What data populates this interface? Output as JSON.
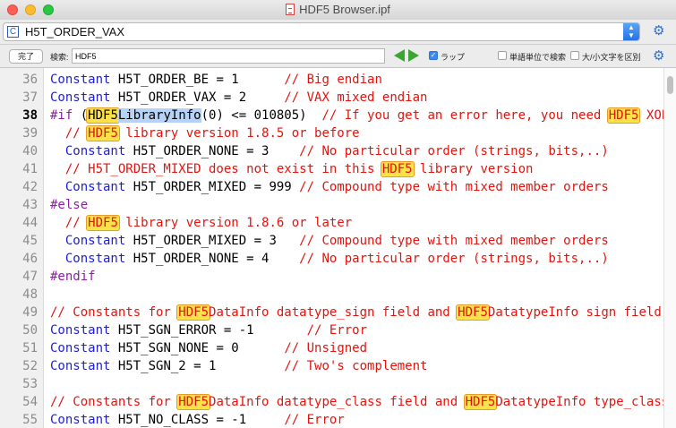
{
  "window": {
    "title": "HDF5 Browser.ipf"
  },
  "proc_menu": {
    "icon": "C",
    "selected": "H5T_ORDER_VAX"
  },
  "find_bar": {
    "done_label": "完了",
    "search_label": "検索:",
    "search_value": "HDF5",
    "wrap_label": "ラップ",
    "wrap_checked": true,
    "word_label": "単語単位で検索",
    "case_label": "大/小文字を区別"
  },
  "lines": [
    {
      "num": "36",
      "segs": [
        {
          "t": "Constant",
          "c": "kw"
        },
        {
          "t": " H5T_ORDER_BE = 1      ",
          "c": "tx"
        },
        {
          "t": "// Big endian",
          "c": "cm"
        }
      ]
    },
    {
      "num": "37",
      "segs": [
        {
          "t": "Constant",
          "c": "kw"
        },
        {
          "t": " H5T_ORDER_VAX = 2     ",
          "c": "tx"
        },
        {
          "t": "// VAX mixed endian",
          "c": "cm"
        }
      ]
    },
    {
      "num": "38",
      "bold": true,
      "segs": [
        {
          "t": "#if",
          "c": "pp"
        },
        {
          "t": " (",
          "c": "tx"
        },
        {
          "t": "HDF5",
          "c": "tx hl"
        },
        {
          "t": "LibraryInfo",
          "c": "tx sel"
        },
        {
          "t": "(0) <= 010805)  ",
          "c": "tx"
        },
        {
          "t": "// If you get an error here, you need ",
          "c": "cm"
        },
        {
          "t": "HDF5",
          "c": "cm hl"
        },
        {
          "t": " XOP",
          "c": "cm"
        }
      ]
    },
    {
      "num": "39",
      "segs": [
        {
          "t": "  // ",
          "c": "cm"
        },
        {
          "t": "HDF5",
          "c": "cm hl"
        },
        {
          "t": " library version 1.8.5 or before",
          "c": "cm"
        }
      ]
    },
    {
      "num": "40",
      "segs": [
        {
          "t": "  ",
          "c": "tx"
        },
        {
          "t": "Constant",
          "c": "kw"
        },
        {
          "t": " H5T_ORDER_NONE = 3    ",
          "c": "tx"
        },
        {
          "t": "// No particular order (strings, bits,..)",
          "c": "cm"
        }
      ]
    },
    {
      "num": "41",
      "segs": [
        {
          "t": "  // H5T_ORDER_MIXED does not exist in this ",
          "c": "cm"
        },
        {
          "t": "HDF5",
          "c": "cm hl"
        },
        {
          "t": " library version",
          "c": "cm"
        }
      ]
    },
    {
      "num": "42",
      "segs": [
        {
          "t": "  ",
          "c": "tx"
        },
        {
          "t": "Constant",
          "c": "kw"
        },
        {
          "t": " H5T_ORDER_MIXED = 999 ",
          "c": "tx"
        },
        {
          "t": "// Compound type with mixed member orders",
          "c": "cm"
        }
      ]
    },
    {
      "num": "43",
      "segs": [
        {
          "t": "#else",
          "c": "pp"
        }
      ]
    },
    {
      "num": "44",
      "segs": [
        {
          "t": "  // ",
          "c": "cm"
        },
        {
          "t": "HDF5",
          "c": "cm hl"
        },
        {
          "t": " library version 1.8.6 or later",
          "c": "cm"
        }
      ]
    },
    {
      "num": "45",
      "segs": [
        {
          "t": "  ",
          "c": "tx"
        },
        {
          "t": "Constant",
          "c": "kw"
        },
        {
          "t": " H5T_ORDER_MIXED = 3   ",
          "c": "tx"
        },
        {
          "t": "// Compound type with mixed member orders",
          "c": "cm"
        }
      ]
    },
    {
      "num": "46",
      "segs": [
        {
          "t": "  ",
          "c": "tx"
        },
        {
          "t": "Constant",
          "c": "kw"
        },
        {
          "t": " H5T_ORDER_NONE = 4    ",
          "c": "tx"
        },
        {
          "t": "// No particular order (strings, bits,..)",
          "c": "cm"
        }
      ]
    },
    {
      "num": "47",
      "segs": [
        {
          "t": "#endif",
          "c": "pp"
        }
      ]
    },
    {
      "num": "48",
      "segs": []
    },
    {
      "num": "49",
      "segs": [
        {
          "t": "// Constants for ",
          "c": "cm"
        },
        {
          "t": "HDF5",
          "c": "cm hl"
        },
        {
          "t": "DataInfo datatype_sign field and ",
          "c": "cm"
        },
        {
          "t": "HDF5",
          "c": "cm hl"
        },
        {
          "t": "DatatypeInfo sign field",
          "c": "cm"
        }
      ]
    },
    {
      "num": "50",
      "segs": [
        {
          "t": "Constant",
          "c": "kw"
        },
        {
          "t": " H5T_SGN_ERROR = -1       ",
          "c": "tx"
        },
        {
          "t": "// Error",
          "c": "cm"
        }
      ]
    },
    {
      "num": "51",
      "segs": [
        {
          "t": "Constant",
          "c": "kw"
        },
        {
          "t": " H5T_SGN_NONE = 0      ",
          "c": "tx"
        },
        {
          "t": "// Unsigned",
          "c": "cm"
        }
      ]
    },
    {
      "num": "52",
      "segs": [
        {
          "t": "Constant",
          "c": "kw"
        },
        {
          "t": " H5T_SGN_2 = 1         ",
          "c": "tx"
        },
        {
          "t": "// Two's complement",
          "c": "cm"
        }
      ]
    },
    {
      "num": "53",
      "segs": []
    },
    {
      "num": "54",
      "segs": [
        {
          "t": "// Constants for ",
          "c": "cm"
        },
        {
          "t": "HDF5",
          "c": "cm hl"
        },
        {
          "t": "DataInfo datatype_class field and ",
          "c": "cm"
        },
        {
          "t": "HDF5",
          "c": "cm hl"
        },
        {
          "t": "DatatypeInfo type_class",
          "c": "cm"
        }
      ]
    },
    {
      "num": "55",
      "segs": [
        {
          "t": "Constant",
          "c": "kw"
        },
        {
          "t": " H5T_NO_CLASS = -1     ",
          "c": "tx"
        },
        {
          "t": "// Error",
          "c": "cm"
        }
      ]
    }
  ]
}
